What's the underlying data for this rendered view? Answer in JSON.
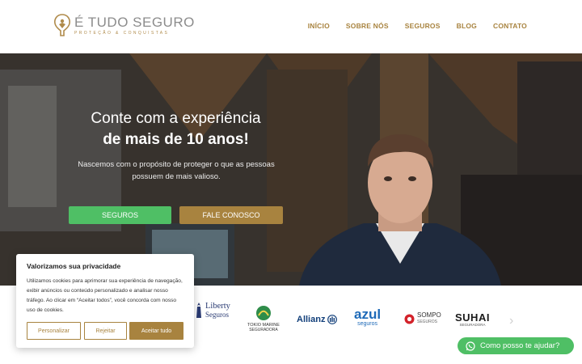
{
  "brand": {
    "name": "É TUDO SEGURO",
    "tagline": "PROTEÇÃO & CONQUISTAS",
    "accent_color": "#a8833f",
    "green_color": "#4fbf65"
  },
  "nav": {
    "items": [
      {
        "label": "INÍCIO"
      },
      {
        "label": "SOBRE NÓS"
      },
      {
        "label": "SEGUROS"
      },
      {
        "label": "BLOG"
      },
      {
        "label": "CONTATO"
      }
    ]
  },
  "hero": {
    "title_line1": "Conte com a experiência",
    "title_line2": "de mais de 10 anos!",
    "description": "Nascemos com o propósito de proteger o que as pessoas possuem de mais valioso.",
    "primary_button": "SEGUROS",
    "secondary_button": "FALE CONOSCO"
  },
  "partners": {
    "logos": [
      {
        "name": "Liberty",
        "sub": "Seguros",
        "icon": "liberty-statue-icon"
      },
      {
        "name": "TOKIO MARINE",
        "sub": "SEGURADORA",
        "icon": "tokio-marine-icon"
      },
      {
        "name": "Allianz",
        "sub": "",
        "icon": "allianz-icon"
      },
      {
        "name": "azul",
        "sub": "seguros",
        "icon": ""
      },
      {
        "name": "SOMPO",
        "sub": "SEGUROS",
        "icon": "sompo-icon"
      },
      {
        "name": "SUHAI",
        "sub": "SEGURADORA",
        "icon": ""
      }
    ],
    "next_icon": "chevron-right-icon"
  },
  "cookie": {
    "title": "Valorizamos sua privacidade",
    "text": "Utilizamos cookies para aprimorar sua experiência de navegação, exibir anúncios ou conteúdo personalizado e analisar nosso tráfego. Ao clicar em “Aceitar todos”, você concorda com nosso uso de cookies.",
    "customize_label": "Personalizar",
    "reject_label": "Rejeitar",
    "accept_label": "Aceitar tudo"
  },
  "whatsapp": {
    "label": "Como posso te ajudar?",
    "icon": "whatsapp-icon"
  }
}
